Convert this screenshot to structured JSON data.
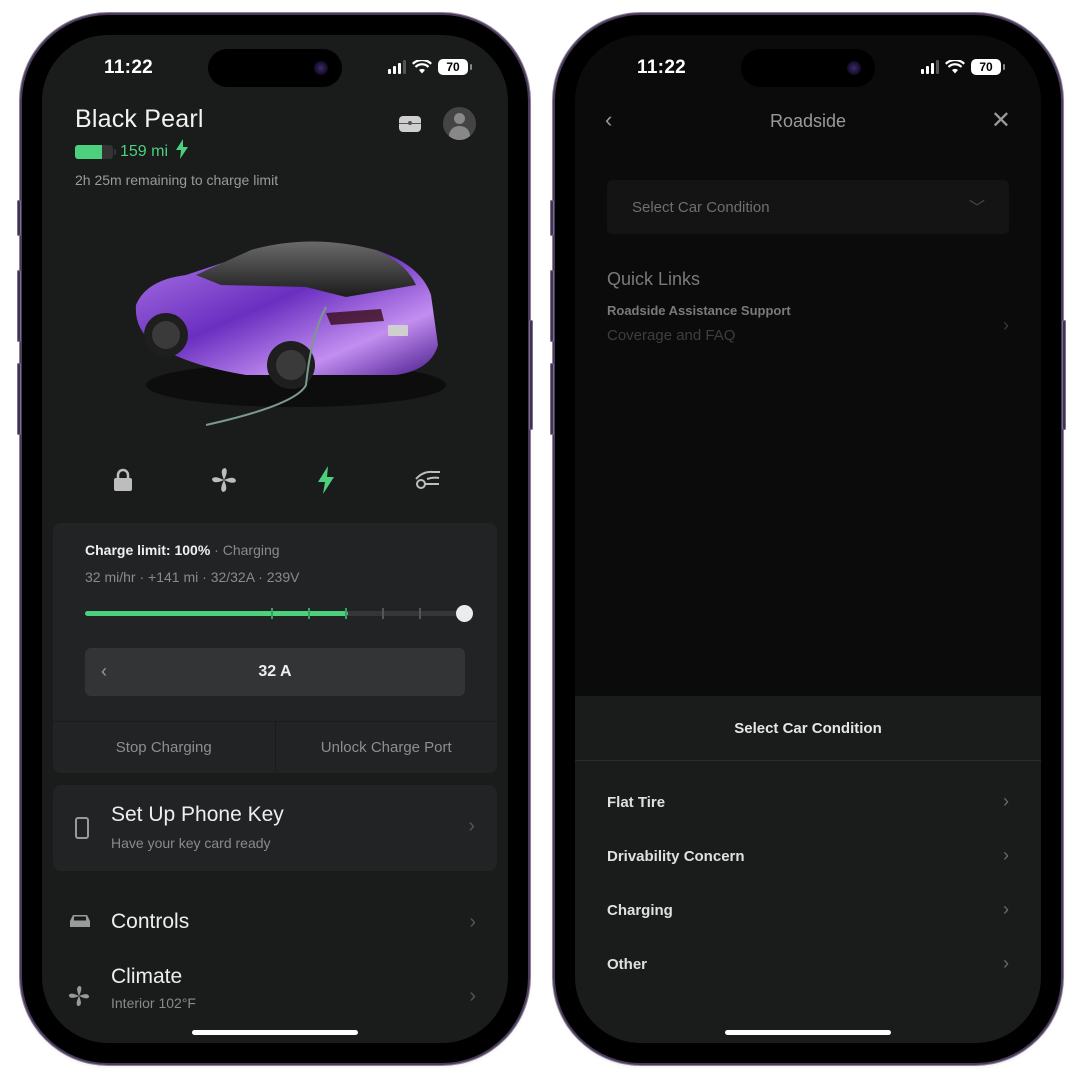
{
  "left_phone": {
    "status_bar": {
      "time": "11:22",
      "battery_percent": "70"
    },
    "vehicle": {
      "name": "Black Pearl",
      "range": "159 mi",
      "battery_level_fraction": 0.71,
      "charge_remaining_text": "2h 25m remaining to charge limit",
      "paint_color": "#8a4fd6"
    },
    "header_icons": [
      "chest-icon",
      "profile-avatar"
    ],
    "quick_controls": [
      {
        "icon": "lock-icon",
        "active": false
      },
      {
        "icon": "fan-icon",
        "active": false
      },
      {
        "icon": "bolt-icon",
        "active": true
      },
      {
        "icon": "frunk-icon",
        "active": false
      }
    ],
    "charging": {
      "limit_label": "Charge limit: 100%",
      "status": "Charging",
      "stats": [
        "32 mi/hr",
        "+141 mi",
        "32/32A",
        "239V"
      ],
      "current_level_percent": 71,
      "limit_percent": 100,
      "tick_marks_percent": [
        50,
        60,
        70,
        80,
        90
      ],
      "amperage": "32 A",
      "stop_label": "Stop Charging",
      "unlock_label": "Unlock Charge Port"
    },
    "phone_key": {
      "title": "Set Up Phone Key",
      "subtitle": "Have your key card ready"
    },
    "menu": [
      {
        "icon": "car-icon",
        "title": "Controls",
        "subtitle": ""
      },
      {
        "icon": "fan-icon",
        "title": "Climate",
        "subtitle": "Interior 102°F"
      }
    ],
    "accent_color": "#4cd07d"
  },
  "right_phone": {
    "status_bar": {
      "time": "11:22",
      "battery_percent": "70"
    },
    "nav": {
      "title": "Roadside"
    },
    "condition_select": {
      "placeholder": "Select Car Condition"
    },
    "quick_links": {
      "title": "Quick Links",
      "items": [
        {
          "title": "Roadside Assistance Support",
          "subtitle": "Coverage and FAQ"
        }
      ]
    },
    "sheet": {
      "title": "Select Car Condition",
      "options": [
        "Flat Tire",
        "Drivability Concern",
        "Charging",
        "Other"
      ]
    }
  }
}
